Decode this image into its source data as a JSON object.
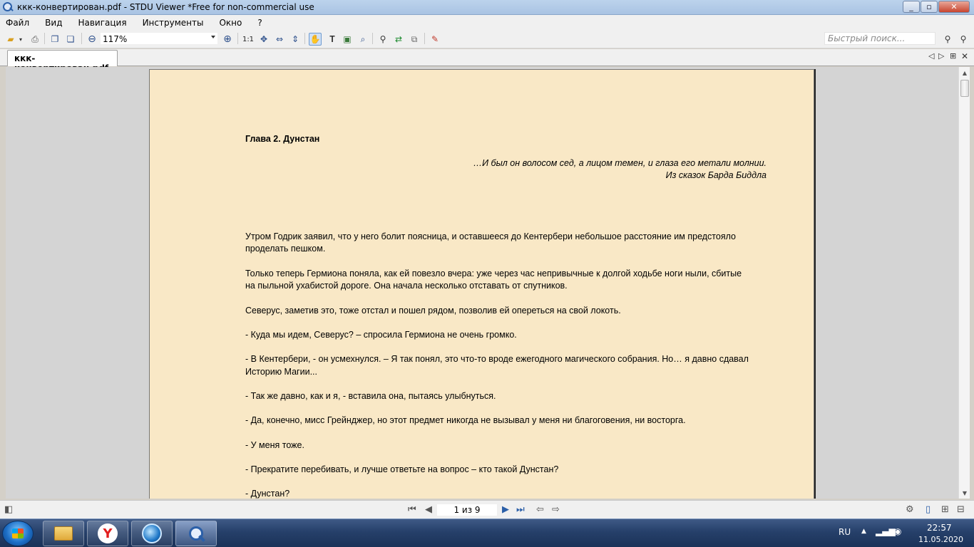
{
  "window": {
    "title": "ккк-конвертирован.pdf - STDU Viewer *Free for non-commercial use"
  },
  "menu": {
    "items": [
      "Файл",
      "Вид",
      "Навигация",
      "Инструменты",
      "Окно",
      "?"
    ]
  },
  "toolbar": {
    "zoom_value": "117%",
    "actual_size_label": "1:1",
    "search_placeholder": "Быстрый поиск..."
  },
  "tabs": {
    "active_label": "ккк-конвертирован.pdf"
  },
  "document": {
    "chapter_title": "Глава 2. Дунстан",
    "epigraph_line1": "…И был он волосом сед, а лицом темен, и глаза его метали молнии.",
    "epigraph_line2": "Из сказок Барда Биддла",
    "paragraphs": [
      [
        "Утром Годрик заявил, что у него болит поясница, и оставшееся до Кентербери небольшое расстояние им предстояло",
        "проделать пешком."
      ],
      [
        "Только теперь Гермиона поняла, как ей повезло вчера: уже через час непривычные к долгой ходьбе ноги ныли, сбитые",
        "на пыльной ухабистой дороге. Она начала несколько отставать от спутников."
      ],
      [
        "Северус, заметив это, тоже отстал и пошел рядом, позволив ей опереться на свой локоть."
      ],
      [
        "- Куда мы идем, Северус? – спросила Гермиона не очень громко."
      ],
      [
        "- В Кентербери, - он усмехнулся. – Я так понял, это что-то вроде ежегодного магического собрания. Но… я давно сдавал",
        "Историю Магии..."
      ],
      [
        "- Так же давно, как и я, - вставила она, пытаясь улыбнуться."
      ],
      [
        "- Да, конечно, мисс Грейнджер, но этот предмет никогда не вызывал у меня ни благоговения, ни восторга."
      ],
      [
        "- У меня тоже."
      ],
      [
        "- Прекратите перебивать, и лучше ответьте на вопрос – кто такой Дунстан?"
      ],
      [
        "- Дунстан?"
      ]
    ]
  },
  "status": {
    "page_indicator": "1 из 9"
  },
  "taskbar": {
    "language": "RU",
    "time": "22:57",
    "date": "11.05.2020"
  },
  "colors": {
    "page_bg": "#f9e8c6",
    "viewer_bg": "#d4d4d4",
    "taskbar": "#26406a"
  }
}
